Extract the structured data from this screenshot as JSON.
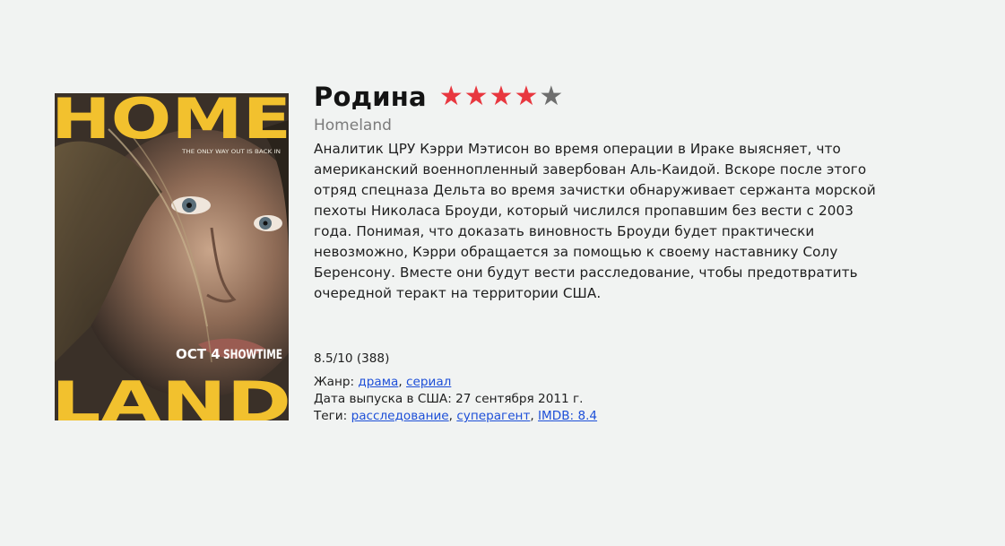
{
  "movie": {
    "title": "Родина",
    "original_title": "Homeland",
    "stars_filled": 4,
    "stars_total": 5,
    "description": "Аналитик ЦРУ Кэрри Мэтисон во время операции в Ираке выясняет, что американский военнопленный завербован Аль-Каидой. Вскоре после этого отряд спецназа Дельта во время зачистки обнаруживает сержанта морской пехоты Николаса Броуди, который числился пропавшим без вести с 2003 года. Понимая, что доказать виновность Броуди будет практически невозможно, Кэрри обращается за помощью к своему наставнику Солу Беренсону. Вместе они будут вести расследование, чтобы предотвратить очередной теракт на территории США.",
    "rating_text": "8.5/10 (388)",
    "genre_label": "Жанр:",
    "genres": [
      "драма",
      "сериал"
    ],
    "release_label": "Дата выпуска в США:",
    "release_date": "27 сентября 2011 г.",
    "tags_label": "Теги:",
    "tags": [
      "расследование",
      "суперагент",
      "IMDB: 8.4"
    ]
  },
  "poster": {
    "top_word": "HOME",
    "bottom_word": "LAND",
    "tagline": "THE ONLY WAY OUT IS BACK IN",
    "date_text": "OCT 4",
    "network": "SHOWTIME"
  },
  "colors": {
    "background": "#f1f3f2",
    "star_on": "#e8373f",
    "star_off": "#6e6e6e",
    "link": "#1d4fd8",
    "poster_yellow": "#f2c12e"
  }
}
